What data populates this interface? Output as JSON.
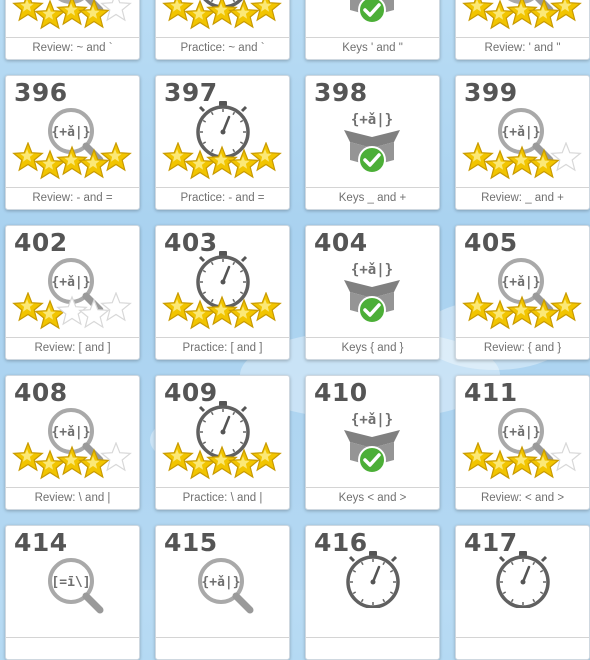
{
  "lessons": [
    {
      "number": "",
      "kind": "review",
      "caption": "Review: ~ and `",
      "stars": 4
    },
    {
      "number": "",
      "kind": "practice",
      "caption": "Practice: ~ and `",
      "stars": 5
    },
    {
      "number": "",
      "kind": "keys",
      "caption": "Keys ' and \"",
      "stars": 0
    },
    {
      "number": "",
      "kind": "review",
      "caption": "Review: ' and \"",
      "stars": 5
    },
    {
      "number": "396",
      "kind": "review",
      "caption": "Review: - and =",
      "stars": 5
    },
    {
      "number": "397",
      "kind": "practice",
      "caption": "Practice: - and =",
      "stars": 5
    },
    {
      "number": "398",
      "kind": "keys",
      "caption": "Keys _ and +",
      "stars": 0
    },
    {
      "number": "399",
      "kind": "review",
      "caption": "Review: _ and +",
      "stars": 4
    },
    {
      "number": "402",
      "kind": "review",
      "caption": "Review: [ and ]",
      "stars": 2
    },
    {
      "number": "403",
      "kind": "practice",
      "caption": "Practice: [ and ]",
      "stars": 5
    },
    {
      "number": "404",
      "kind": "keys",
      "caption": "Keys { and }",
      "stars": 0
    },
    {
      "number": "405",
      "kind": "review",
      "caption": "Review: { and }",
      "stars": 5
    },
    {
      "number": "408",
      "kind": "review",
      "caption": "Review: \\ and |",
      "stars": 4
    },
    {
      "number": "409",
      "kind": "practice",
      "caption": "Practice: \\ and |",
      "stars": 5
    },
    {
      "number": "410",
      "kind": "keys",
      "caption": "Keys < and >",
      "stars": 0
    },
    {
      "number": "411",
      "kind": "review",
      "caption": "Review: < and >",
      "stars": 4
    },
    {
      "number": "414",
      "kind": "review-alt",
      "caption": "",
      "stars": 0
    },
    {
      "number": "415",
      "kind": "review",
      "caption": "",
      "stars": 0
    },
    {
      "number": "416",
      "kind": "practice",
      "caption": "",
      "stars": 0
    },
    {
      "number": "417",
      "kind": "practice",
      "caption": "",
      "stars": 0
    }
  ],
  "icon_glyphs": {
    "keys_symbol": "{+ǎ|}",
    "review_alt_symbol": "[=ī\\]"
  },
  "colors": {
    "star_gold": "#f2c500",
    "check_green": "#4caf37",
    "icon_gray": "#6f6f6f"
  }
}
